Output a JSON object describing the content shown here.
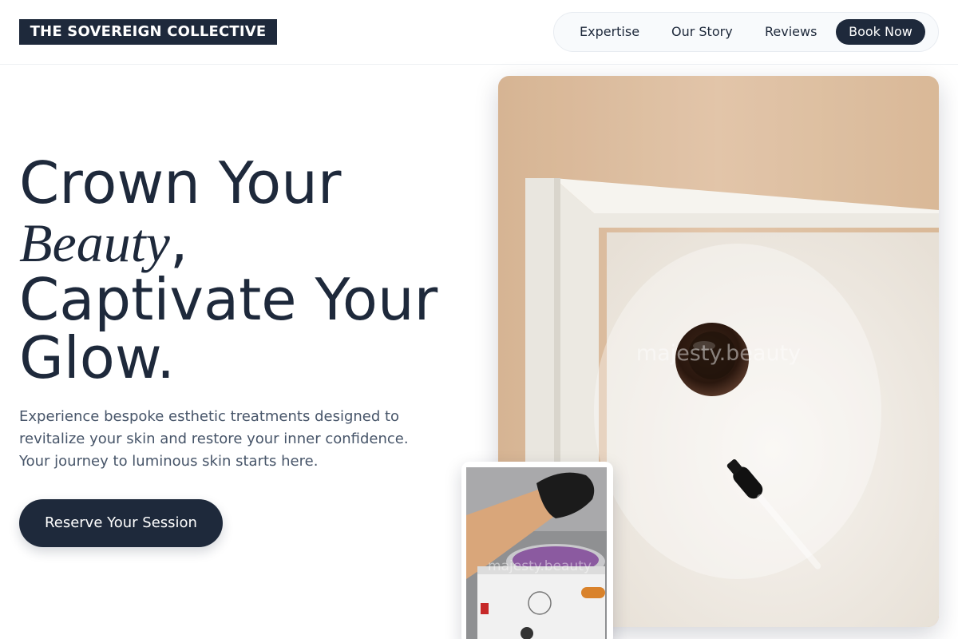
{
  "brand": {
    "name": "THE SOVEREIGN COLLECTIVE"
  },
  "nav": {
    "items": [
      "Expertise",
      "Our Story",
      "Reviews"
    ],
    "book_label": "Book Now"
  },
  "hero": {
    "line1": "Crown Your",
    "line2_italic": "Beauty",
    "line2_rest": ",",
    "line3": "Captivate Your",
    "line4": "Glow.",
    "subtext": "Experience bespoke esthetic treatments designed to revitalize your skin and restore your inner confidence. Your journey to luminous skin starts here.",
    "cta_label": "Reserve Your Session"
  },
  "images": {
    "main_watermark": "majesty.beauty",
    "small_watermark": "majesty.beauty"
  },
  "colors": {
    "primary": "#1e293b",
    "body_text": "#475569",
    "nav_bg": "#f8fafc"
  }
}
